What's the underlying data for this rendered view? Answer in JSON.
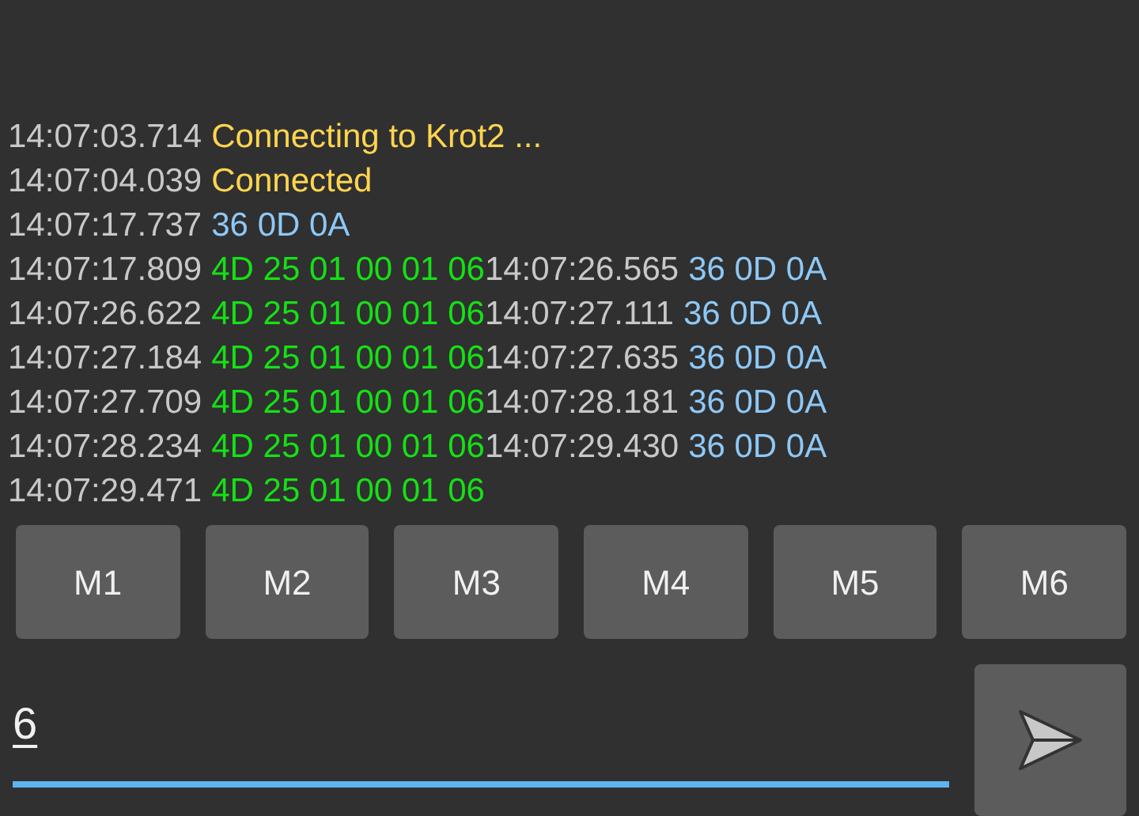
{
  "log": [
    {
      "segments": [
        {
          "kind": "time",
          "text": "14:07:03.714"
        },
        {
          "kind": "status",
          "text": "Connecting to Krot2 ..."
        }
      ]
    },
    {
      "segments": [
        {
          "kind": "time",
          "text": "14:07:04.039"
        },
        {
          "kind": "status",
          "text": "Connected"
        }
      ]
    },
    {
      "segments": [
        {
          "kind": "time",
          "text": "14:07:17.737"
        },
        {
          "kind": "sent",
          "text": "36 0D 0A"
        }
      ]
    },
    {
      "segments": [
        {
          "kind": "time",
          "text": "14:07:17.809"
        },
        {
          "kind": "received",
          "text": "4D 25 01 00 01 06"
        },
        {
          "kind": "time",
          "text": "14:07:26.565"
        },
        {
          "kind": "sent",
          "text": "36 0D 0A"
        }
      ]
    },
    {
      "segments": [
        {
          "kind": "time",
          "text": "14:07:26.622"
        },
        {
          "kind": "received",
          "text": "4D 25 01 00 01 06"
        },
        {
          "kind": "time",
          "text": "14:07:27.111"
        },
        {
          "kind": "sent",
          "text": "36 0D 0A"
        }
      ]
    },
    {
      "segments": [
        {
          "kind": "time",
          "text": "14:07:27.184"
        },
        {
          "kind": "received",
          "text": "4D 25 01 00 01 06"
        },
        {
          "kind": "time",
          "text": "14:07:27.635"
        },
        {
          "kind": "sent",
          "text": "36 0D 0A"
        }
      ]
    },
    {
      "segments": [
        {
          "kind": "time",
          "text": "14:07:27.709"
        },
        {
          "kind": "received",
          "text": "4D 25 01 00 01 06"
        },
        {
          "kind": "time",
          "text": "14:07:28.181"
        },
        {
          "kind": "sent",
          "text": "36 0D 0A"
        }
      ]
    },
    {
      "segments": [
        {
          "kind": "time",
          "text": "14:07:28.234"
        },
        {
          "kind": "received",
          "text": "4D 25 01 00 01 06"
        },
        {
          "kind": "time",
          "text": "14:07:29.430"
        },
        {
          "kind": "sent",
          "text": "36 0D 0A"
        }
      ]
    },
    {
      "segments": [
        {
          "kind": "time",
          "text": "14:07:29.471"
        },
        {
          "kind": "received",
          "text": "4D 25 01 00 01 06"
        }
      ]
    }
  ],
  "macro_buttons": [
    "M1",
    "M2",
    "M3",
    "M4",
    "M5",
    "M6"
  ],
  "input": {
    "value": "6"
  }
}
